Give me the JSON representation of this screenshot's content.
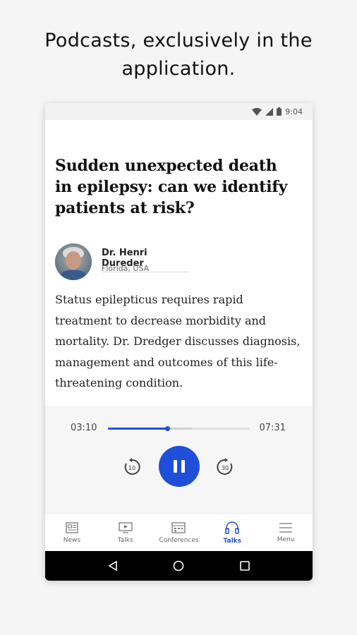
{
  "headline": {
    "line1": "Podcasts, exclusively in the",
    "line2": "application."
  },
  "status_bar": {
    "time": "9:04"
  },
  "article": {
    "title": "Sudden unexpected death in epilepsy: can we identify patients at risk?",
    "author_name": "Dr. Henri Dureder",
    "author_location": "Florida, USA",
    "description": "Status epilepticus requires rapid treatment to decrease morbidity and mortality. Dr. Dredger discusses diagnosis, management and outcomes of this life-threatening condition."
  },
  "player": {
    "current_time": "03:10",
    "total_time": "07:31",
    "progress_fraction": 0.42,
    "buffered_fraction": 0.59,
    "rewind_seconds": "10",
    "forward_seconds": "30"
  },
  "nav": {
    "items": [
      {
        "label": "News",
        "icon": "news-icon",
        "active": false
      },
      {
        "label": "Talks",
        "icon": "play-screen-icon",
        "active": false
      },
      {
        "label": "Conferences",
        "icon": "calendar-icon",
        "active": false
      },
      {
        "label": "Talks",
        "icon": "headphones-icon",
        "active": true
      },
      {
        "label": "Menu",
        "icon": "menu-icon",
        "active": false
      }
    ]
  },
  "colors": {
    "accent": "#1f4fd8",
    "page_background": "#f5f5f5",
    "system_nav": "#000000"
  }
}
